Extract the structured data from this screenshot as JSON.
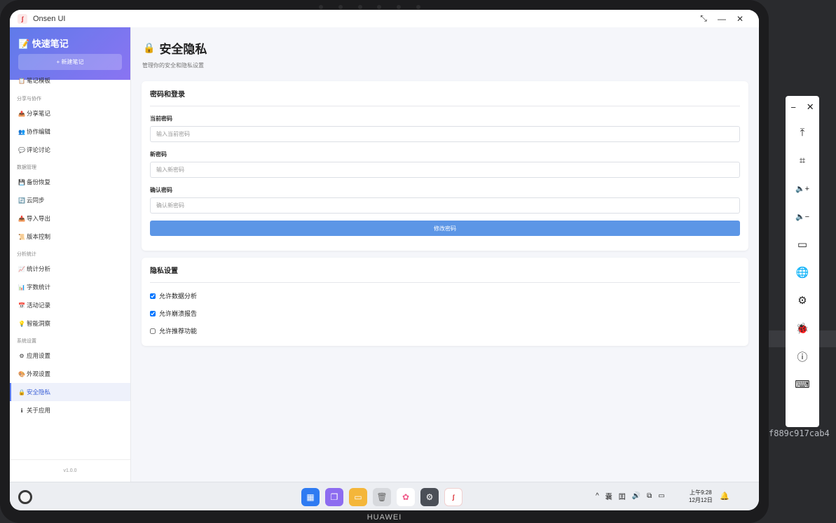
{
  "window": {
    "app_name": "Onsen UI",
    "logo_text": "ʃ",
    "controls": [
      "⤡",
      "—",
      "✕"
    ]
  },
  "sidebar": {
    "title": "📝 快速笔记",
    "new_button": "+ 新建笔记",
    "top_item": {
      "icon": "📋",
      "label": "笔记模板"
    },
    "sections": [
      {
        "title": "分享与协作",
        "items": [
          {
            "icon": "📤",
            "label": "分享笔记"
          },
          {
            "icon": "👥",
            "label": "协作编辑"
          },
          {
            "icon": "💬",
            "label": "评论讨论"
          }
        ]
      },
      {
        "title": "数据管理",
        "items": [
          {
            "icon": "💾",
            "label": "备份恢复"
          },
          {
            "icon": "🔄",
            "label": "云同步"
          },
          {
            "icon": "📥",
            "label": "导入导出"
          },
          {
            "icon": "📜",
            "label": "版本控制"
          }
        ]
      },
      {
        "title": "分析统计",
        "items": [
          {
            "icon": "📈",
            "label": "统计分析"
          },
          {
            "icon": "📊",
            "label": "字数统计"
          },
          {
            "icon": "📅",
            "label": "活动记录"
          },
          {
            "icon": "💡",
            "label": "智能洞察"
          }
        ]
      },
      {
        "title": "系统设置",
        "items": [
          {
            "icon": "⚙",
            "label": "应用设置"
          },
          {
            "icon": "🎨",
            "label": "外观设置"
          },
          {
            "icon": "🔒",
            "label": "安全隐私"
          },
          {
            "icon": "ℹ",
            "label": "关于应用"
          }
        ]
      }
    ],
    "version": "v1.0.0"
  },
  "main": {
    "title": "安全隐私",
    "title_icon": "🔒",
    "subtitle": "管理你的安全和隐私设置",
    "password_card": {
      "title": "密码和登录",
      "current_label": "当前密码",
      "current_placeholder": "输入当前密码",
      "new_label": "新密码",
      "new_placeholder": "输入新密码",
      "confirm_label": "确认密码",
      "confirm_placeholder": "确认新密码",
      "submit": "修改密码"
    },
    "privacy_card": {
      "title": "隐私设置",
      "options": [
        {
          "label": "允许数据分析",
          "checked": true
        },
        {
          "label": "允许崩溃报告",
          "checked": true
        },
        {
          "label": "允许推荐功能",
          "checked": false
        }
      ]
    }
  },
  "taskbar": {
    "dock": [
      "▦",
      "❐",
      "▭",
      "🗑",
      "✿",
      "⚙",
      "ʃ"
    ],
    "tray": [
      "^",
      "囊",
      "囯",
      "🔊",
      "⧉",
      "▭"
    ],
    "time": "上午9:28",
    "date": "12月12日",
    "bell": "🔔"
  },
  "device": {
    "brand": "HUAWEI"
  },
  "float_panel": {
    "top": [
      "−",
      "✕"
    ],
    "tools": [
      "⤒",
      "⌗",
      "🔈+",
      "🔈−",
      "▭",
      "🌐",
      "⚙",
      "🐞",
      "ⓘ",
      "⌨"
    ]
  },
  "hash_text": "f889c917cab4"
}
